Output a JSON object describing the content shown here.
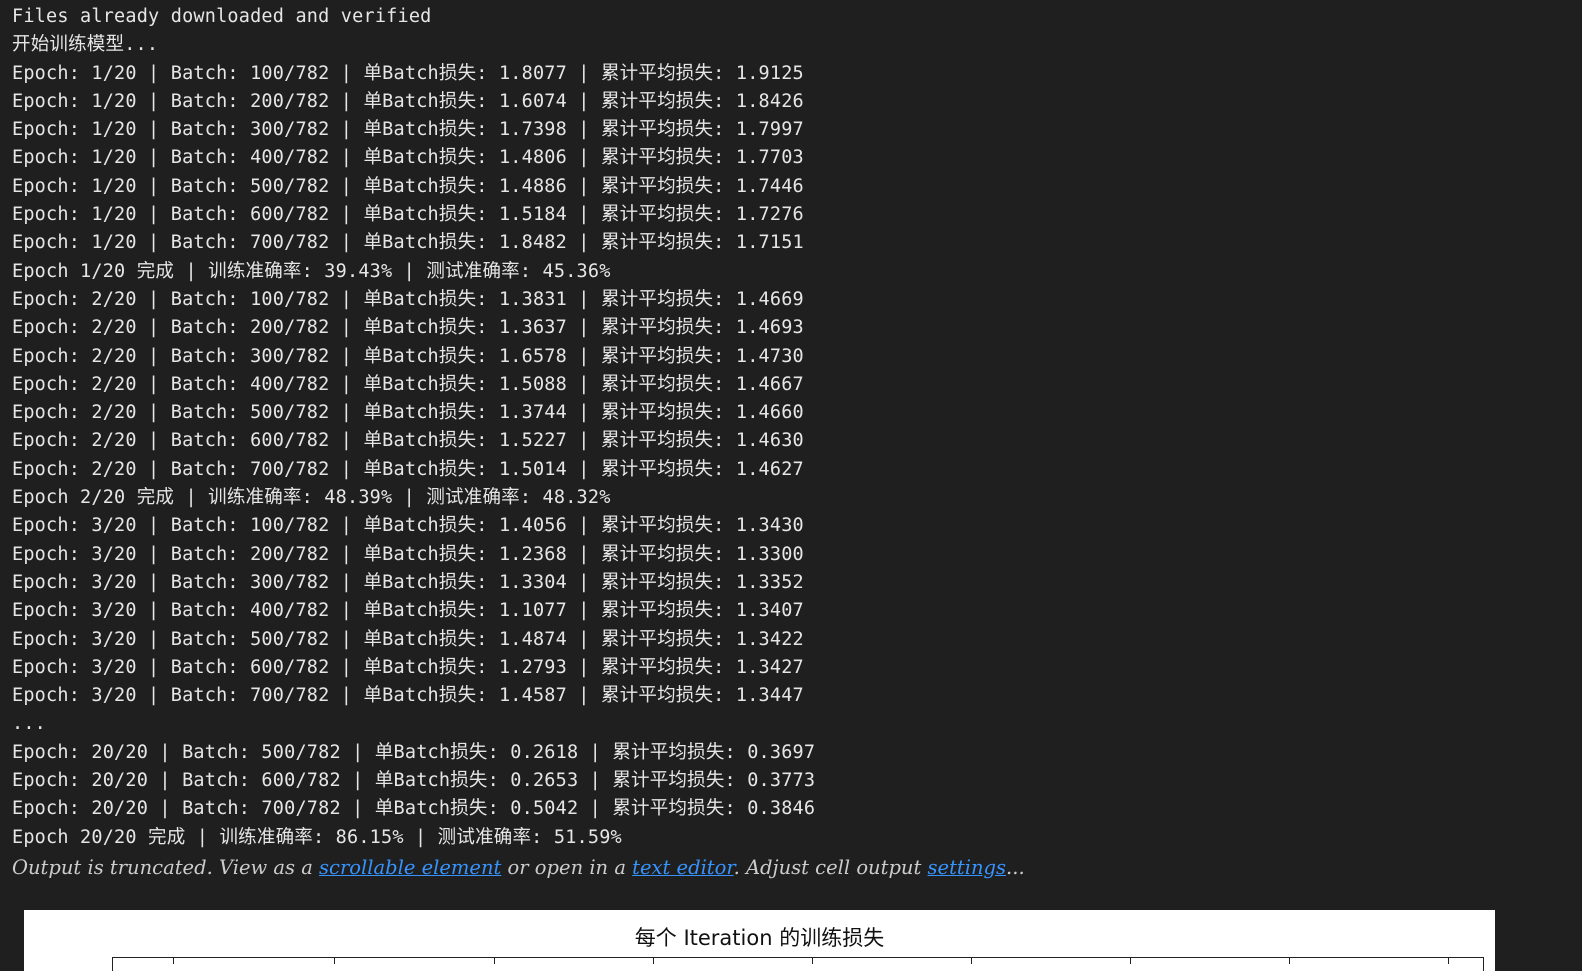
{
  "log_lines": [
    "Files already downloaded and verified",
    "开始训练模型...",
    "Epoch: 1/20 | Batch: 100/782 | 单Batch损失: 1.8077 | 累计平均损失: 1.9125",
    "Epoch: 1/20 | Batch: 200/782 | 单Batch损失: 1.6074 | 累计平均损失: 1.8426",
    "Epoch: 1/20 | Batch: 300/782 | 单Batch损失: 1.7398 | 累计平均损失: 1.7997",
    "Epoch: 1/20 | Batch: 400/782 | 单Batch损失: 1.4806 | 累计平均损失: 1.7703",
    "Epoch: 1/20 | Batch: 500/782 | 单Batch损失: 1.4886 | 累计平均损失: 1.7446",
    "Epoch: 1/20 | Batch: 600/782 | 单Batch损失: 1.5184 | 累计平均损失: 1.7276",
    "Epoch: 1/20 | Batch: 700/782 | 单Batch损失: 1.8482 | 累计平均损失: 1.7151",
    "Epoch 1/20 完成 | 训练准确率: 39.43% | 测试准确率: 45.36%",
    "Epoch: 2/20 | Batch: 100/782 | 单Batch损失: 1.3831 | 累计平均损失: 1.4669",
    "Epoch: 2/20 | Batch: 200/782 | 单Batch损失: 1.3637 | 累计平均损失: 1.4693",
    "Epoch: 2/20 | Batch: 300/782 | 单Batch损失: 1.6578 | 累计平均损失: 1.4730",
    "Epoch: 2/20 | Batch: 400/782 | 单Batch损失: 1.5088 | 累计平均损失: 1.4667",
    "Epoch: 2/20 | Batch: 500/782 | 单Batch损失: 1.3744 | 累计平均损失: 1.4660",
    "Epoch: 2/20 | Batch: 600/782 | 单Batch损失: 1.5227 | 累计平均损失: 1.4630",
    "Epoch: 2/20 | Batch: 700/782 | 单Batch损失: 1.5014 | 累计平均损失: 1.4627",
    "Epoch 2/20 完成 | 训练准确率: 48.39% | 测试准确率: 48.32%",
    "Epoch: 3/20 | Batch: 100/782 | 单Batch损失: 1.4056 | 累计平均损失: 1.3430",
    "Epoch: 3/20 | Batch: 200/782 | 单Batch损失: 1.2368 | 累计平均损失: 1.3300",
    "Epoch: 3/20 | Batch: 300/782 | 单Batch损失: 1.3304 | 累计平均损失: 1.3352",
    "Epoch: 3/20 | Batch: 400/782 | 单Batch损失: 1.1077 | 累计平均损失: 1.3407",
    "Epoch: 3/20 | Batch: 500/782 | 单Batch损失: 1.4874 | 累计平均损失: 1.3422",
    "Epoch: 3/20 | Batch: 600/782 | 单Batch损失: 1.2793 | 累计平均损失: 1.3427",
    "Epoch: 3/20 | Batch: 700/782 | 单Batch损失: 1.4587 | 累计平均损失: 1.3447",
    "...",
    "Epoch: 20/20 | Batch: 500/782 | 单Batch损失: 0.2618 | 累计平均损失: 0.3697",
    "Epoch: 20/20 | Batch: 600/782 | 单Batch损失: 0.2653 | 累计平均损失: 0.3773",
    "Epoch: 20/20 | Batch: 700/782 | 单Batch损失: 0.5042 | 累计平均损失: 0.3846",
    "Epoch 20/20 完成 | 训练准确率: 86.15% | 测试准确率: 51.59%"
  ],
  "truncation": {
    "prefix": "Output is truncated. View as a ",
    "scrollable_link": "scrollable element",
    "middle": " or open in a ",
    "editor_link": "text editor",
    "middle2": ". Adjust cell output ",
    "settings_link": "settings",
    "suffix": "..."
  },
  "figure": {
    "title": "每个 Iteration 的训练损失"
  },
  "colors": {
    "background": "#1f1f1f",
    "text": "#e6e6e6",
    "link": "#3794ff",
    "figure_bg": "#ffffff"
  }
}
